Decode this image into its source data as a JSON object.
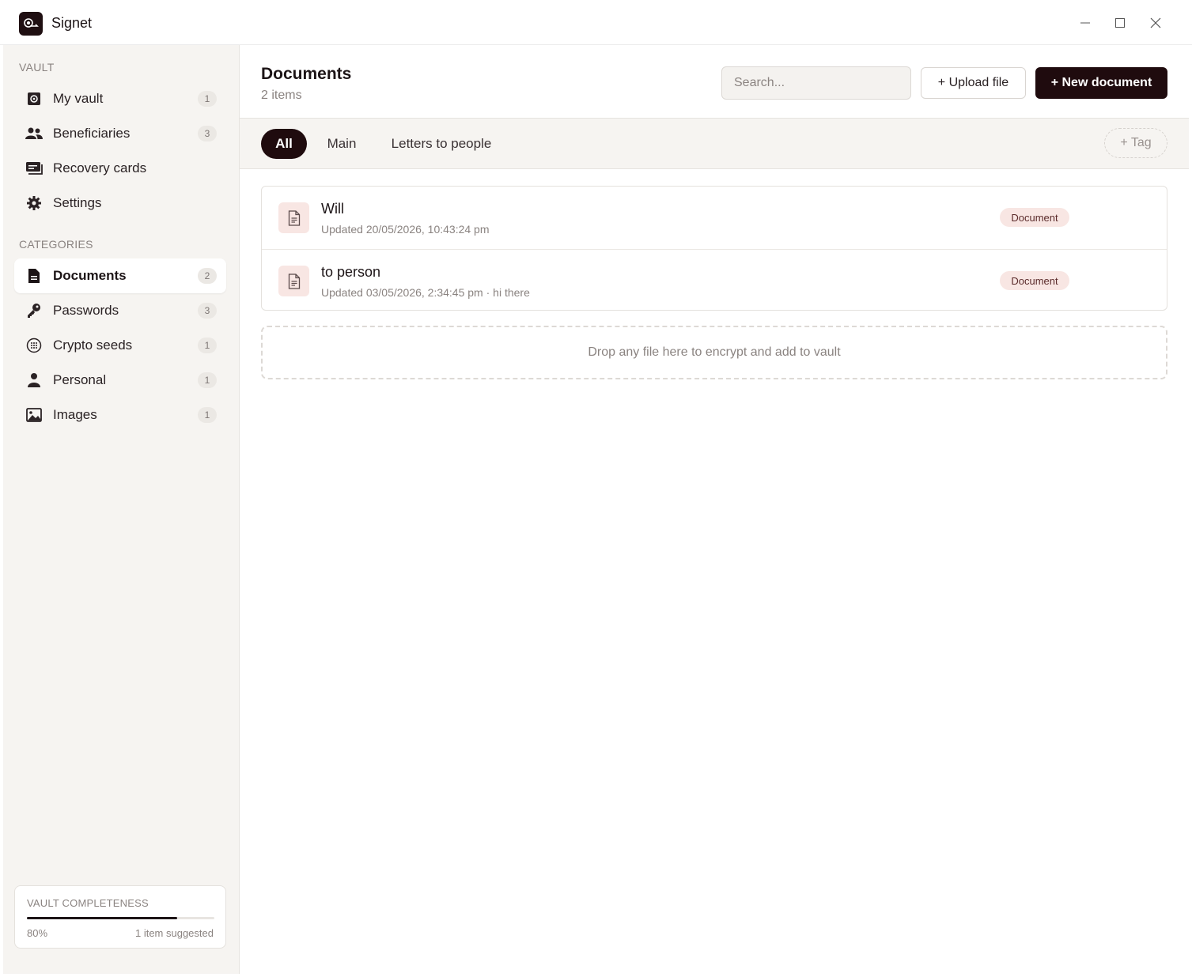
{
  "app": {
    "title": "Signet"
  },
  "sidebar": {
    "vault_label": "VAULT",
    "vault_items": [
      {
        "label": "My vault",
        "count": "1",
        "icon": "vault-icon"
      },
      {
        "label": "Beneficiaries",
        "count": "3",
        "icon": "people-icon"
      },
      {
        "label": "Recovery cards",
        "icon": "cards-icon"
      },
      {
        "label": "Settings",
        "icon": "gear-icon"
      }
    ],
    "categories_label": "CATEGORIES",
    "category_items": [
      {
        "label": "Documents",
        "count": "2",
        "icon": "document-icon",
        "active": true
      },
      {
        "label": "Passwords",
        "count": "3",
        "icon": "key-icon"
      },
      {
        "label": "Crypto seeds",
        "count": "1",
        "icon": "seed-grid-icon"
      },
      {
        "label": "Personal",
        "count": "1",
        "icon": "person-icon"
      },
      {
        "label": "Images",
        "count": "1",
        "icon": "image-icon"
      }
    ],
    "completeness": {
      "title": "VAULT COMPLETENESS",
      "percent_label": "80%",
      "percent": 0.8,
      "suggested": "1 item suggested"
    }
  },
  "main": {
    "title": "Documents",
    "count": "2 items",
    "search_placeholder": "Search...",
    "upload_label": "+ Upload file",
    "new_label": "+ New document",
    "tabs": [
      {
        "label": "All",
        "active": true
      },
      {
        "label": "Main"
      },
      {
        "label": "Letters to people"
      }
    ],
    "tag_label": "+ Tag",
    "documents": [
      {
        "title": "Will",
        "meta": "Updated 20/05/2026, 10:43:24 pm",
        "badge": "Document"
      },
      {
        "title": "to person",
        "meta": "Updated 03/05/2026, 2:34:45 pm · hi there",
        "badge": "Document"
      }
    ],
    "dropzone_text": "Drop any file here to encrypt and add to vault"
  },
  "colors": {
    "accent": "#1f0b0e",
    "badge_bg": "#f8e6e3",
    "sidebar_bg": "#f6f4f1"
  }
}
